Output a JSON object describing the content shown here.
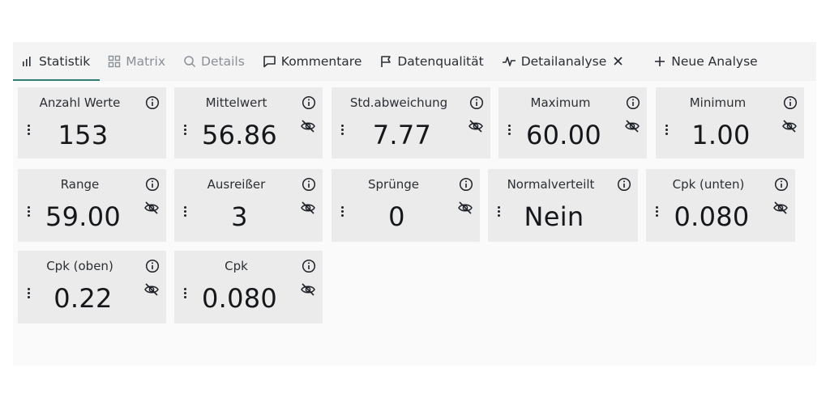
{
  "tabs": [
    {
      "label": "Statistik",
      "icon": "bar-chart-icon",
      "state": "active"
    },
    {
      "label": "Matrix",
      "icon": "grid-icon",
      "state": "disabled"
    },
    {
      "label": "Details",
      "icon": "search-icon",
      "state": "disabled"
    },
    {
      "label": "Kommentare",
      "icon": "comment-icon",
      "state": "normal"
    },
    {
      "label": "Datenqualität",
      "icon": "flag-icon",
      "state": "normal"
    },
    {
      "label": "Detailanalyse",
      "icon": "pulse-icon",
      "state": "normal",
      "closable": true
    },
    {
      "label": "Neue Analyse",
      "icon": "plus-icon",
      "state": "normal"
    }
  ],
  "cards": [
    {
      "label": "Anzahl Werte",
      "value": "153",
      "hidden_icon": false
    },
    {
      "label": "Mittelwert",
      "value": "56.86",
      "hidden_icon": true
    },
    {
      "label": "Std.abweichung",
      "value": "7.77",
      "hidden_icon": true
    },
    {
      "label": "Maximum",
      "value": "60.00",
      "hidden_icon": true
    },
    {
      "label": "Minimum",
      "value": "1.00",
      "hidden_icon": true
    },
    {
      "label": "Range",
      "value": "59.00",
      "hidden_icon": true
    },
    {
      "label": "Ausreißer",
      "value": "3",
      "hidden_icon": true
    },
    {
      "label": "Sprünge",
      "value": "0",
      "hidden_icon": true
    },
    {
      "label": "Normalverteilt",
      "value": "Nein",
      "hidden_icon": false
    },
    {
      "label": "Cpk (unten)",
      "value": "0.080",
      "hidden_icon": true
    },
    {
      "label": "Cpk (oben)",
      "value": "0.22",
      "hidden_icon": true
    },
    {
      "label": "Cpk",
      "value": "0.080",
      "hidden_icon": true
    }
  ],
  "colors": {
    "active_tab_underline": "#2e7d73",
    "card_bg": "#ebebeb",
    "tabbar_bg": "#f4f4f4"
  }
}
